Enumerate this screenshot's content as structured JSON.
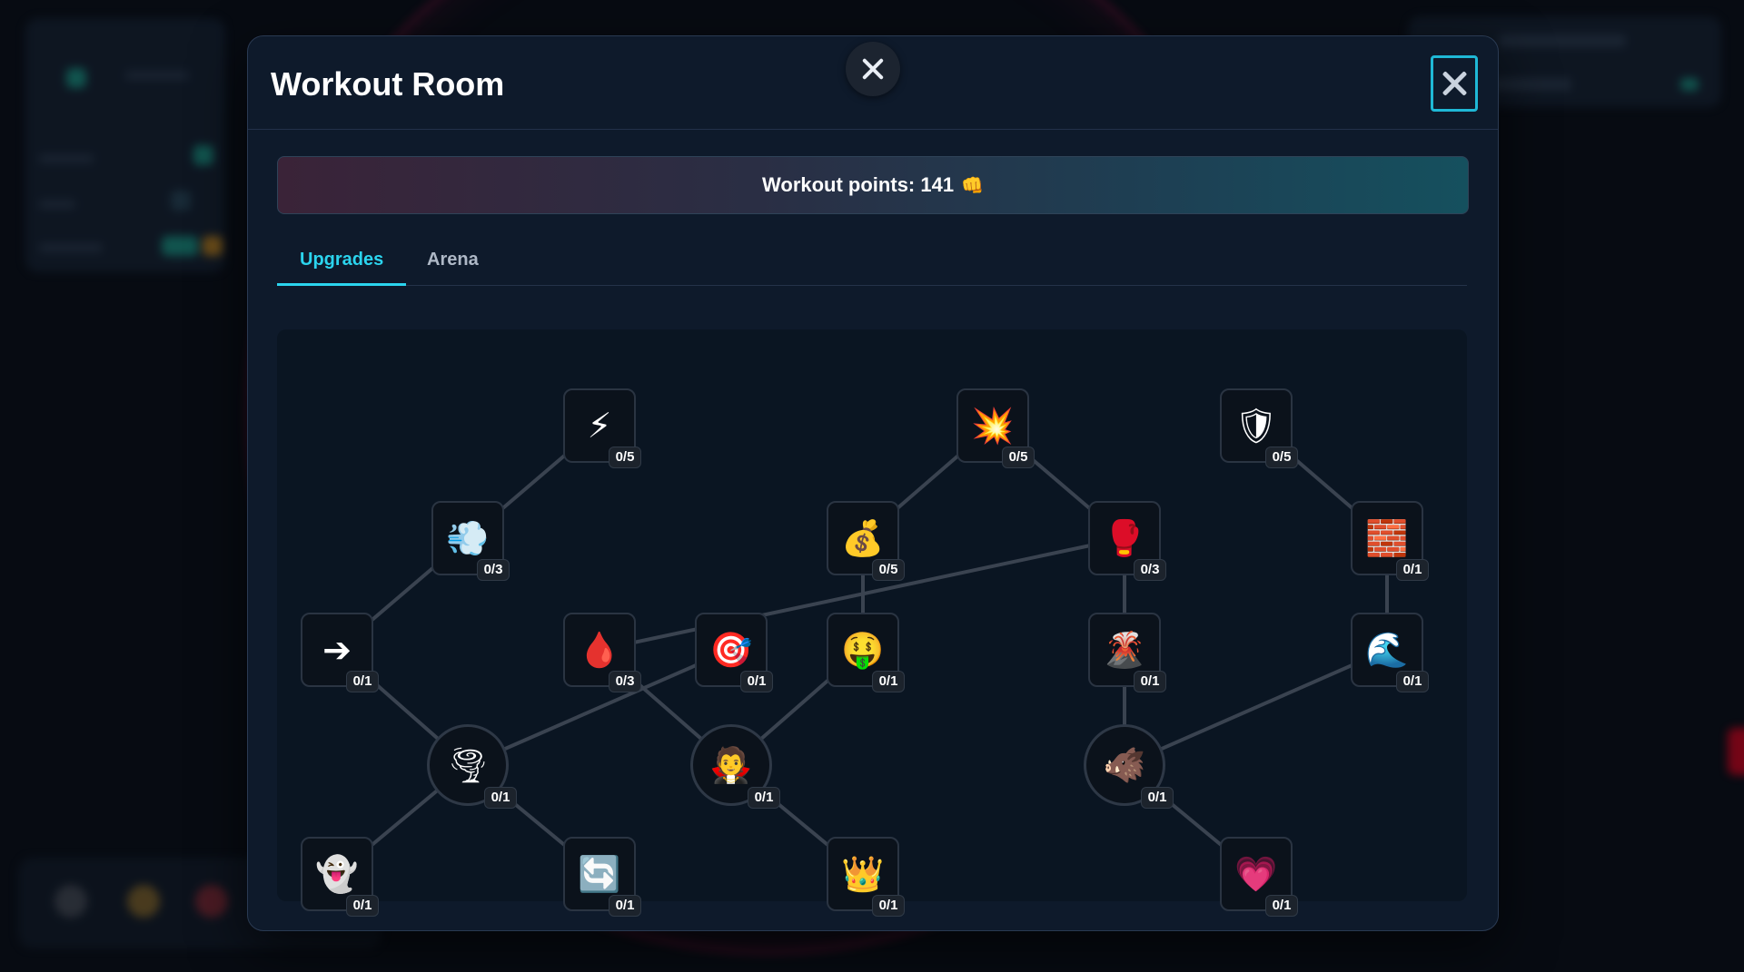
{
  "modal": {
    "title": "Workout Room",
    "points_label": "Workout points: 141",
    "points_icon": "fist-icon",
    "tabs": [
      {
        "label": "Upgrades",
        "active": true
      },
      {
        "label": "Arena",
        "active": false
      }
    ]
  },
  "colors": {
    "accent": "#2bd4ee",
    "panel": "#0e1a2b",
    "tree_bg": "#0a1522",
    "link": "#3a4350"
  },
  "upgrades": [
    {
      "id": "lightning",
      "icon": "lightning-icon",
      "glyph": "⚡",
      "level": "0/5"
    },
    {
      "id": "explosion",
      "icon": "explosion-icon",
      "glyph": "💥",
      "level": "0/5"
    },
    {
      "id": "shield",
      "icon": "shield-icon",
      "glyph": "🛡",
      "level": "0/5"
    },
    {
      "id": "dash",
      "icon": "dash-icon",
      "glyph": "💨",
      "level": "0/3"
    },
    {
      "id": "money-bag",
      "icon": "money-bag-icon",
      "glyph": "💰",
      "level": "0/5"
    },
    {
      "id": "boxing-glove",
      "icon": "boxing-glove-icon",
      "glyph": "🥊",
      "level": "0/3"
    },
    {
      "id": "brick",
      "icon": "brick-wall-icon",
      "glyph": "🧱",
      "level": "0/1"
    },
    {
      "id": "arrow",
      "icon": "arrow-right-icon",
      "glyph": "➔",
      "level": "0/1"
    },
    {
      "id": "drop",
      "icon": "blood-drop-icon",
      "glyph": "🩸",
      "level": "0/3"
    },
    {
      "id": "target",
      "icon": "target-icon",
      "glyph": "🎯",
      "level": "0/1"
    },
    {
      "id": "money-face",
      "icon": "money-face-icon",
      "glyph": "🤑",
      "level": "0/1"
    },
    {
      "id": "volcano",
      "icon": "volcano-icon",
      "glyph": "🌋",
      "level": "0/1"
    },
    {
      "id": "wave",
      "icon": "wave-icon",
      "glyph": "🌊",
      "level": "0/1"
    },
    {
      "id": "tornado",
      "icon": "tornado-icon",
      "glyph": "🌪",
      "level": "0/1"
    },
    {
      "id": "vampire",
      "icon": "vampire-icon",
      "glyph": "🧛",
      "level": "0/1"
    },
    {
      "id": "boar",
      "icon": "boar-icon",
      "glyph": "🐗",
      "level": "0/1"
    },
    {
      "id": "ghost",
      "icon": "ghost-icon",
      "glyph": "👻",
      "level": "0/1"
    },
    {
      "id": "refresh",
      "icon": "refresh-icon",
      "glyph": "🔄",
      "level": "0/1"
    },
    {
      "id": "crown",
      "icon": "crown-icon",
      "glyph": "👑",
      "level": "0/1"
    },
    {
      "id": "heart",
      "icon": "heart-icon",
      "glyph": "💗",
      "level": "0/1"
    }
  ]
}
